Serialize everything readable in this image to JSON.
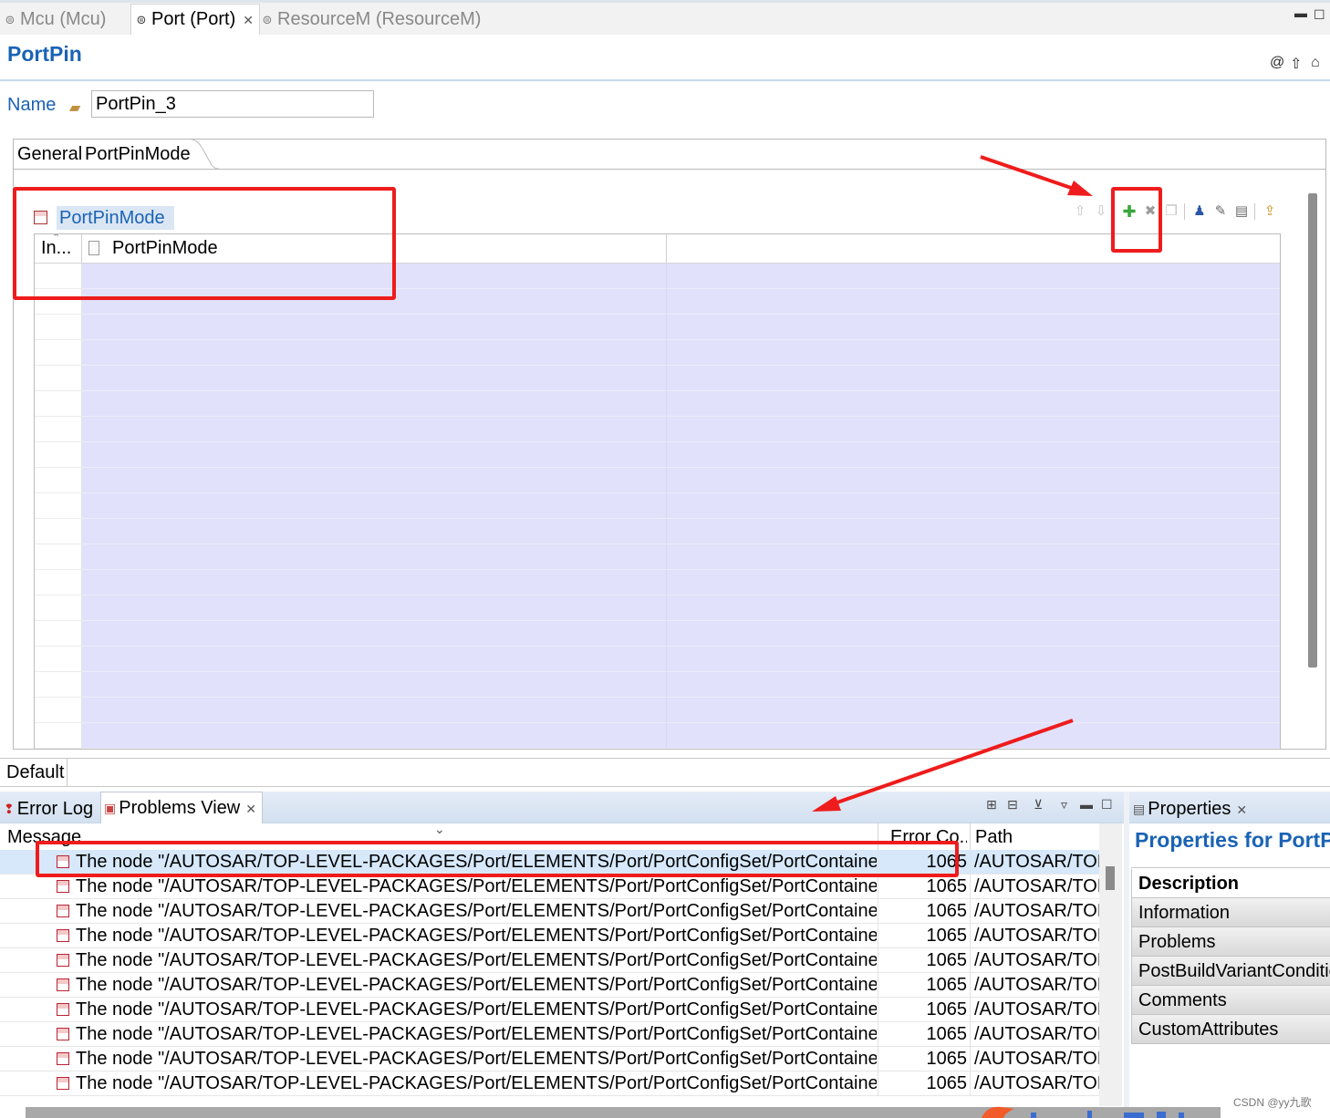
{
  "editor_tabs": [
    {
      "label": "Mcu (Mcu)",
      "active": false
    },
    {
      "label": "Port (Port)",
      "active": true
    },
    {
      "label": "ResourceM (ResourceM)",
      "active": false
    }
  ],
  "form": {
    "title": "PortPin",
    "name_label": "Name",
    "name_value": "PortPin_3"
  },
  "inner_tabs": [
    "General",
    "PortPinMode"
  ],
  "section": {
    "title": "PortPinMode",
    "columns": [
      "In...",
      "PortPinMode"
    ],
    "row_count": 19
  },
  "default_tab": "Default",
  "bottom_tabs": {
    "error_log": "Error Log",
    "problems_view": "Problems View",
    "properties": "Properties"
  },
  "problems": {
    "columns": [
      "Message",
      "Error Co...",
      "Path"
    ],
    "rows": [
      {
        "message": "The node \"/AUTOSAR/TOP-LEVEL-PACKAGES/Port/ELEMENTS/Port/PortConfigSet/PortContainer/Port",
        "code": "1065",
        "path": "/AUTOSAR/TOP",
        "selected": true
      },
      {
        "message": "The node \"/AUTOSAR/TOP-LEVEL-PACKAGES/Port/ELEMENTS/Port/PortConfigSet/PortContainer/Port",
        "code": "1065",
        "path": "/AUTOSAR/TOP",
        "selected": false
      },
      {
        "message": "The node \"/AUTOSAR/TOP-LEVEL-PACKAGES/Port/ELEMENTS/Port/PortConfigSet/PortContainer/Port",
        "code": "1065",
        "path": "/AUTOSAR/TOP",
        "selected": false
      },
      {
        "message": "The node \"/AUTOSAR/TOP-LEVEL-PACKAGES/Port/ELEMENTS/Port/PortConfigSet/PortContainer/Port",
        "code": "1065",
        "path": "/AUTOSAR/TOP",
        "selected": false
      },
      {
        "message": "The node \"/AUTOSAR/TOP-LEVEL-PACKAGES/Port/ELEMENTS/Port/PortConfigSet/PortContainer/Port",
        "code": "1065",
        "path": "/AUTOSAR/TOP",
        "selected": false
      },
      {
        "message": "The node \"/AUTOSAR/TOP-LEVEL-PACKAGES/Port/ELEMENTS/Port/PortConfigSet/PortContainer/Port",
        "code": "1065",
        "path": "/AUTOSAR/TOP",
        "selected": false
      },
      {
        "message": "The node \"/AUTOSAR/TOP-LEVEL-PACKAGES/Port/ELEMENTS/Port/PortConfigSet/PortContainer/Port",
        "code": "1065",
        "path": "/AUTOSAR/TOP",
        "selected": false
      },
      {
        "message": "The node \"/AUTOSAR/TOP-LEVEL-PACKAGES/Port/ELEMENTS/Port/PortConfigSet/PortContainer/Port",
        "code": "1065",
        "path": "/AUTOSAR/TOP",
        "selected": false
      },
      {
        "message": "The node \"/AUTOSAR/TOP-LEVEL-PACKAGES/Port/ELEMENTS/Port/PortConfigSet/PortContainer/Port",
        "code": "1065",
        "path": "/AUTOSAR/TOP",
        "selected": false
      },
      {
        "message": "The node \"/AUTOSAR/TOP-LEVEL-PACKAGES/Port/ELEMENTS/Port/PortConfigSet/PortContainer/Port",
        "code": "1065",
        "path": "/AUTOSAR/TOP",
        "selected": false
      }
    ]
  },
  "properties": {
    "title": "Properties for PortP",
    "items": [
      "Description",
      "Information",
      "Problems",
      "PostBuildVariantConditio",
      "Comments",
      "CustomAttributes"
    ],
    "active_item": "Description"
  },
  "watermark": "CSDN @yy九歌",
  "icons": {
    "editor_tab": "config-file-icon",
    "name_field": "folder-open-icon",
    "section": "container-icon",
    "toolbar": [
      "move-up-icon",
      "move-down-icon",
      "add-icon",
      "delete-icon",
      "copy-icon",
      "user-icon",
      "edit-icon",
      "table-edit-icon",
      "export-icon"
    ],
    "header": [
      "help-icon",
      "navigate-up-icon",
      "home-icon"
    ]
  },
  "colors": {
    "accent_blue": "#1a63b5",
    "row_fill": "#e1e1fb",
    "annotation_red": "#ee1c1c",
    "add_green": "#3aa53a"
  }
}
